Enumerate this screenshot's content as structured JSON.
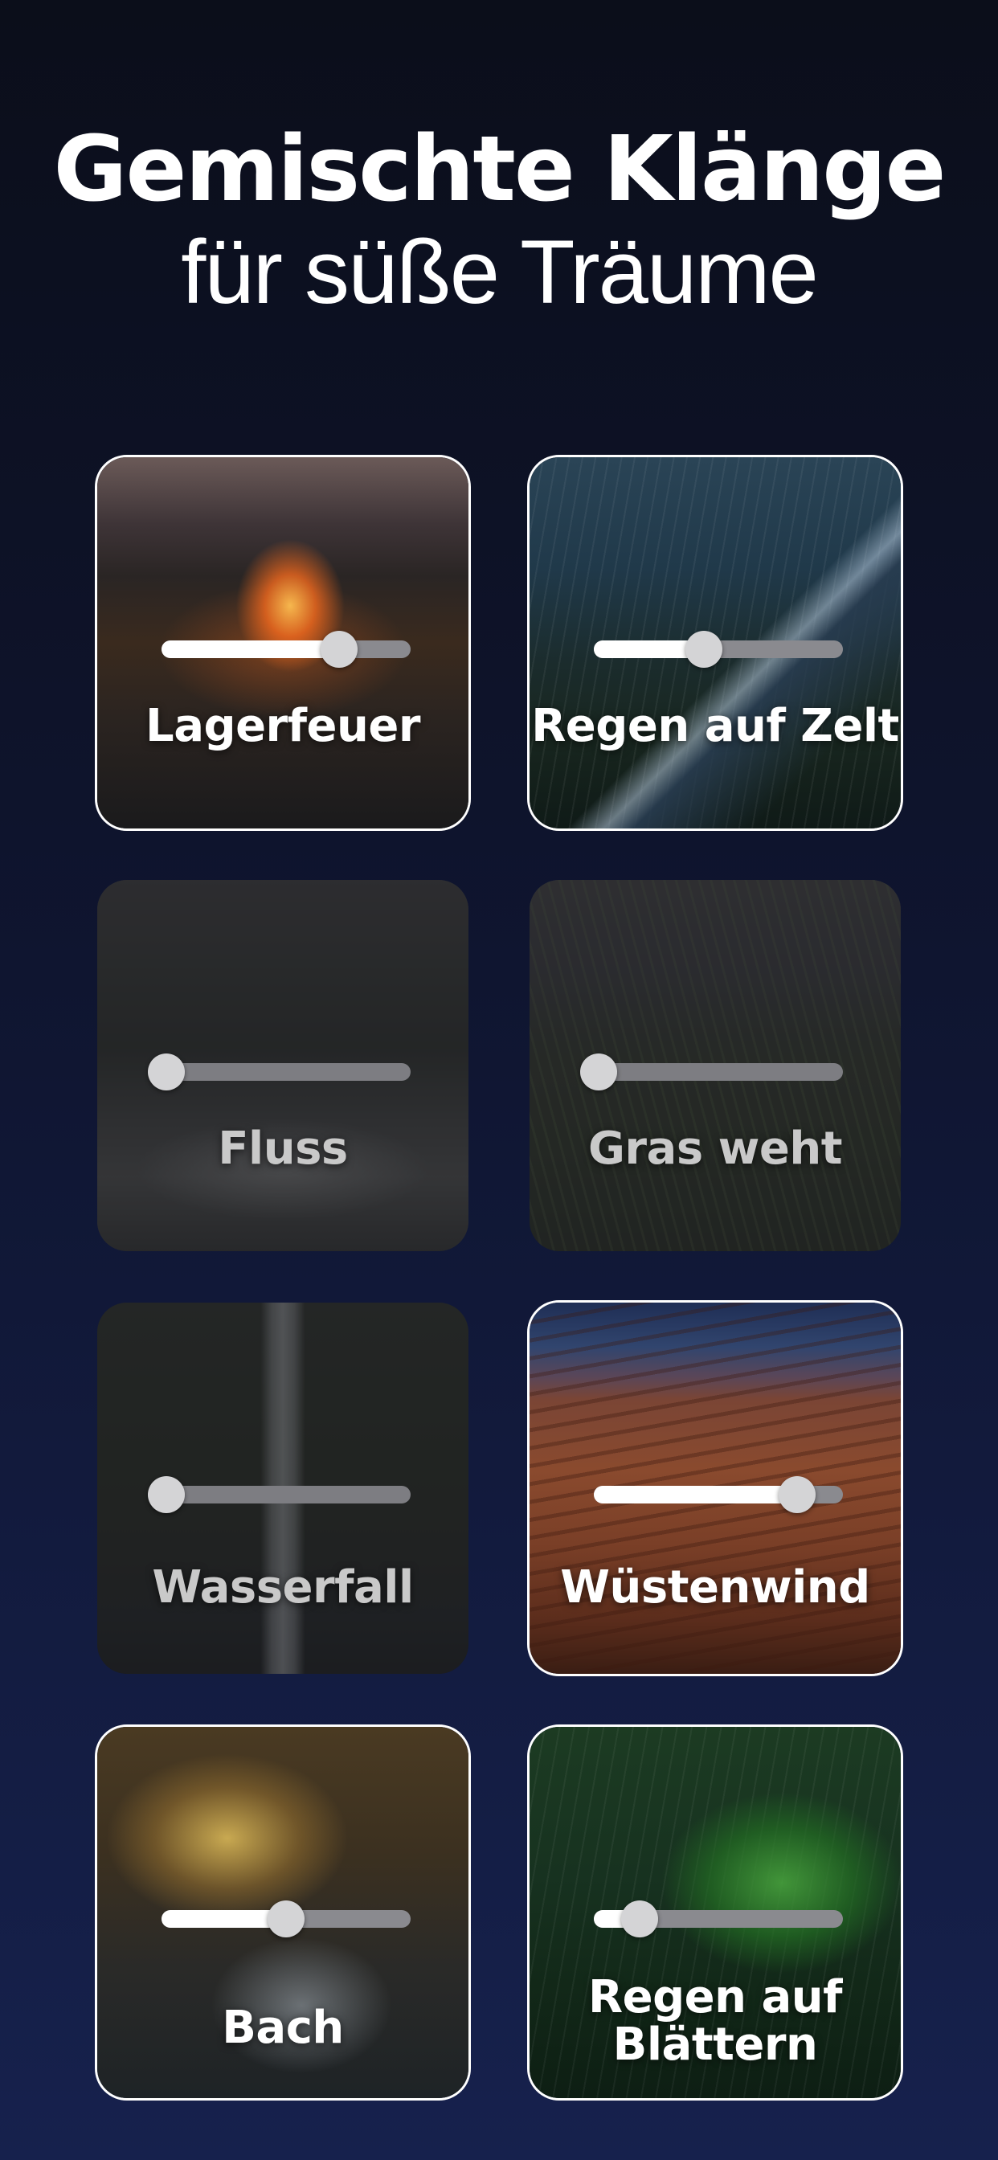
{
  "header": {
    "title": "Gemischte Klänge",
    "subtitle": "für süße Träume"
  },
  "sounds": [
    {
      "label": "Lagerfeuer",
      "active": true,
      "volume": 0.72,
      "icon": "campfire-image"
    },
    {
      "label": "Regen auf Zelt",
      "active": true,
      "volume": 0.44,
      "icon": "rain-tent-image"
    },
    {
      "label": "Fluss",
      "active": false,
      "volume": 0.0,
      "icon": "river-image"
    },
    {
      "label": "Gras weht",
      "active": false,
      "volume": 0.0,
      "icon": "grass-image"
    },
    {
      "label": "Wasserfall",
      "active": false,
      "volume": 0.0,
      "icon": "waterfall-image"
    },
    {
      "label": "Wüstenwind",
      "active": true,
      "volume": 0.83,
      "icon": "desert-image"
    },
    {
      "label": "Bach",
      "active": true,
      "volume": 0.5,
      "icon": "stream-image"
    },
    {
      "label": "Regen auf Blättern",
      "active": true,
      "volume": 0.17,
      "icon": "rain-leaves-image"
    }
  ]
}
